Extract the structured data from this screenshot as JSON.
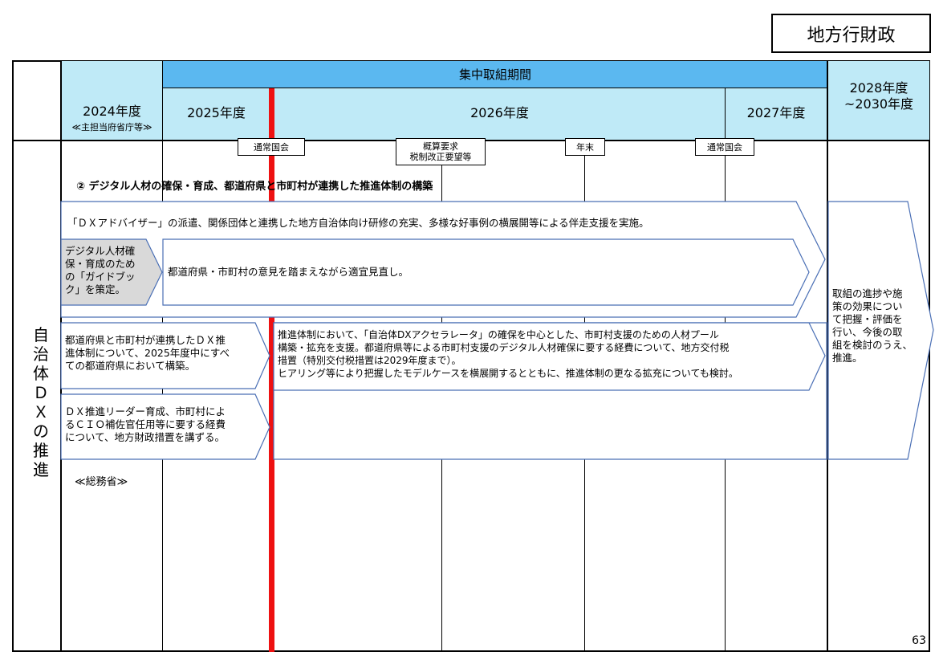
{
  "category": "地方行財政",
  "header": {
    "fiscal_2024": "2024年度",
    "fiscal_2024_sub": "≪主担当府省庁等≫",
    "focus_period": "集中取組期間",
    "fiscal_2025": "2025年度",
    "fiscal_2026": "2026年度",
    "fiscal_2027": "2027年度",
    "fiscal_2028_line1": "2028年度",
    "fiscal_2028_line2": "~2030年度"
  },
  "milestones": {
    "ordinary_diet_1": "通常国会",
    "budget_request_line1": "概算要求",
    "budget_request_line2": "税制改正要望等",
    "year_end": "年末",
    "ordinary_diet_2": "通常国会"
  },
  "row_label": [
    "自",
    "治",
    "体",
    "Ｄ",
    "Ｘ",
    "の",
    "推",
    "進"
  ],
  "section_title": "② デジタル人材の確保・育成、都道府県と市町村が連携した推進体制の構築",
  "items": {
    "advisor": "「ＤＸアドバイザー」の派遣、関係団体と連携した地方自治体向け研修の充実、多様な好事例の横展開等による伴走支援を実施。",
    "guidebook": [
      "デジタル人材確",
      "保・育成のため",
      "の「ガイドブッ",
      "ク」を策定。"
    ],
    "review": "都道府県・市町村の意見を踏まえながら適宜見直し。",
    "structure": [
      "都道府県と市町村が連携したＤＸ推",
      "進体制について、2025年度中にすべ",
      "ての都道府県において構築。"
    ],
    "accelerator": [
      "推進体制において、「自治体DXアクセラレータ」の確保を中心とした、市町村支援のための人材プール",
      "構築・拡充を支援。都道府県等による市町村支援のデジタル人材確保に要する経費について、地方交付税",
      "措置（特別交付税措置は2029年度まで）。",
      "ヒアリング等により把握したモデルケースを横展開するとともに、推進体制の更なる拡充についても検討。"
    ],
    "leader": [
      "ＤＸ推進リーダー育成、市町村によ",
      "るＣＩＯ補佐官任用等に要する経費",
      "について、地方財政措置を講ずる。"
    ],
    "future": [
      "取組の進捗や施",
      "策の効果につい",
      "て把握・評価を",
      "行い、今後の取",
      "組を検討のうえ、",
      "推進。"
    ]
  },
  "ministry": "≪総務省≫",
  "page_number": "63",
  "colors": {
    "header_light": "#bfeaf7",
    "header_blue": "#5bb8f0",
    "red_line": "#ee1111",
    "arrow_stroke": "#4a6fb5",
    "guidebook_fill": "#d9d9d9"
  }
}
